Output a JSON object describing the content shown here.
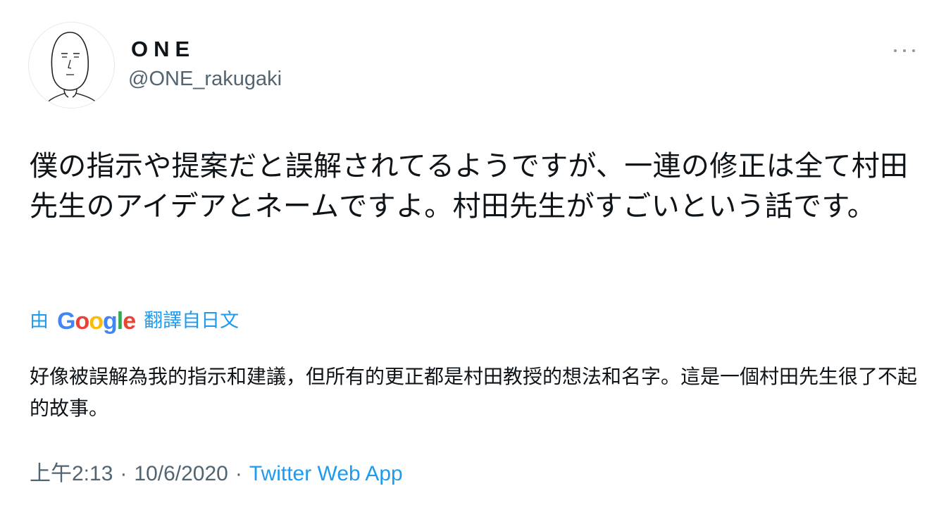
{
  "user": {
    "display_name": "ONE",
    "handle": "@ONE_rakugaki",
    "avatar_icon": "sketch-face-avatar"
  },
  "menu": {
    "icon": "more-dots-icon"
  },
  "tweet": {
    "text": "僕の指示や提案だと誤解されてるようですが、一連の修正は全て村田先生のアイデアとネームですよ。村田先生がすごいという話です。"
  },
  "translation": {
    "prefix": "由",
    "provider_letters": [
      "G",
      "o",
      "o",
      "g",
      "l",
      "e"
    ],
    "suffix": "翻譯自日文",
    "text": "好像被誤解為我的指示和建議，但所有的更正都是村田教授的想法和名字。這是一個村田先生很了不起的故事。"
  },
  "meta": {
    "time": "上午2:13",
    "separator": "·",
    "date": "10/6/2020",
    "source": "Twitter Web App"
  },
  "colors": {
    "accent": "#1d9bf0",
    "secondary_text": "#536471",
    "primary_text": "#0f1419"
  }
}
